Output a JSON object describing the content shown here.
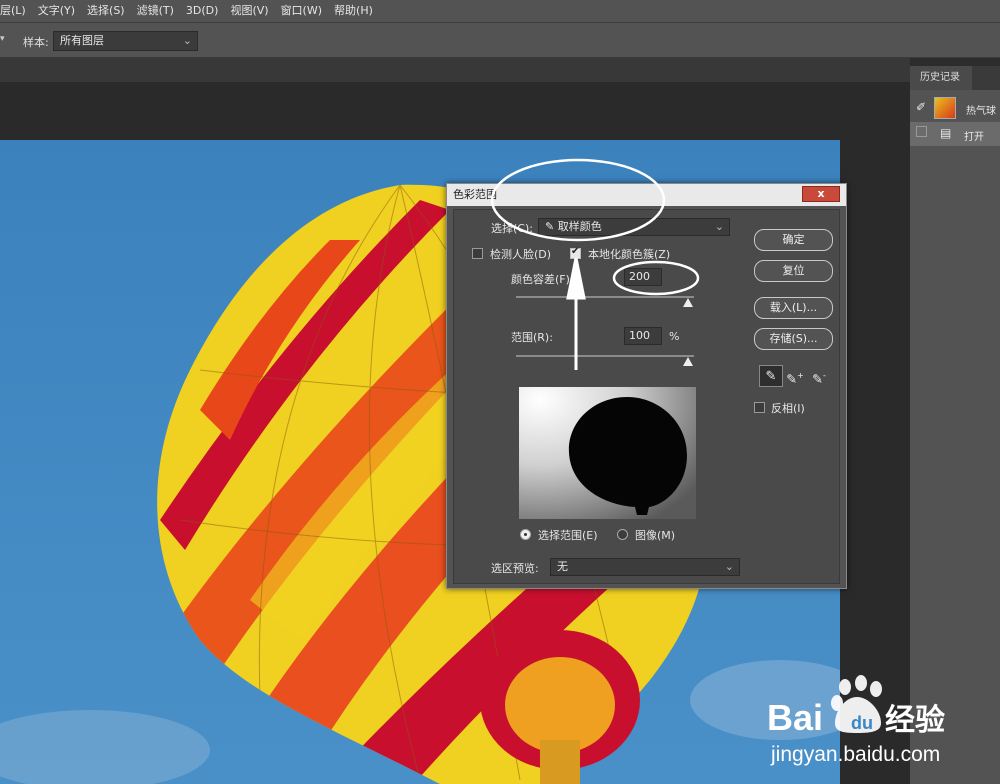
{
  "menubar": {
    "items": [
      "层(L)",
      "文字(Y)",
      "选择(S)",
      "滤镜(T)",
      "3D(D)",
      "视图(V)",
      "窗口(W)",
      "帮助(H)"
    ]
  },
  "options": {
    "arrow": "▾",
    "sample_label": "样本:",
    "sample_value": "所有图层"
  },
  "history_panel": {
    "tab_label": "历史记录",
    "snapshot_label": "热气球",
    "step_label": "打开"
  },
  "dialog": {
    "title": "色彩范围",
    "close": "x",
    "select_label": "选择(C):",
    "select_value": "取样颜色",
    "detect_faces_label": "检测人脸(D)",
    "detect_faces_checked": false,
    "localized_label": "本地化颜色簇(Z)",
    "localized_checked": true,
    "fuzziness_label": "颜色容差(F):",
    "fuzziness_value": "200",
    "range_label": "范围(R):",
    "range_value": "100",
    "range_unit": "%",
    "radio_selection_label": "选择范围(E)",
    "radio_image_label": "图像(M)",
    "preview_label": "选区预览:",
    "preview_value": "无",
    "ok_label": "确定",
    "reset_label": "复位",
    "load_label": "载入(L)...",
    "save_label": "存储(S)...",
    "invert_label": "反相(I)",
    "invert_checked": false
  },
  "watermark": {
    "brand": "Bai",
    "brand2": "du",
    "suffix": "经验",
    "url": "jingyan.baidu.com"
  }
}
